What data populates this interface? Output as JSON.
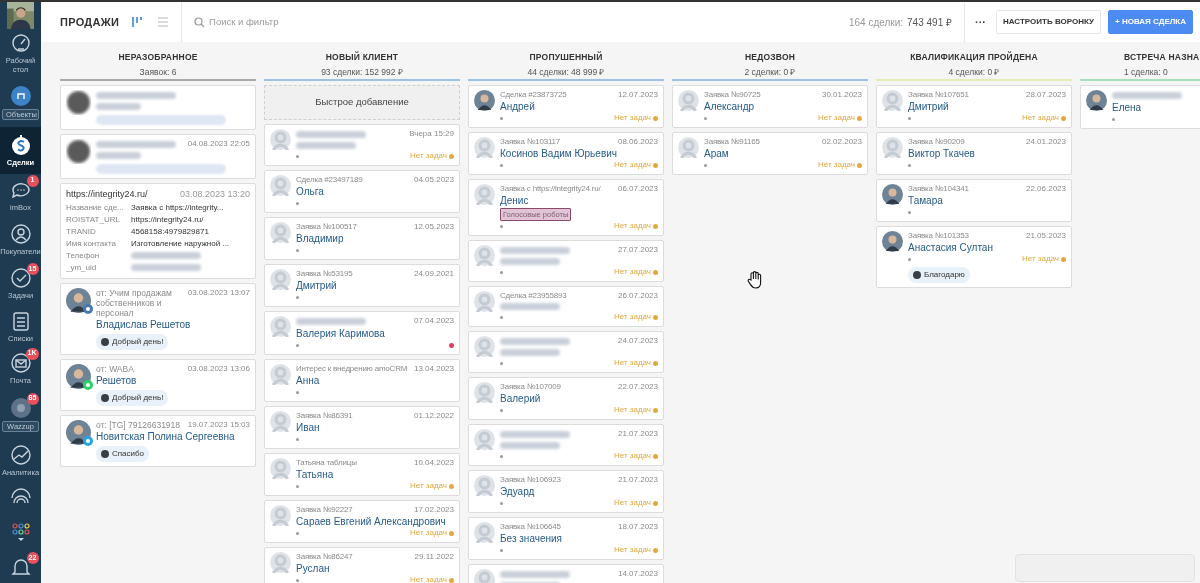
{
  "sidebar": {
    "items": [
      {
        "label": "Рабочий стол",
        "selected": false,
        "kind": "plain"
      },
      {
        "label": "Объекты",
        "selected": false,
        "kind": "boxed"
      },
      {
        "label": "Сделки",
        "selected": true,
        "kind": "plain"
      },
      {
        "label": "imBox",
        "selected": false,
        "kind": "plain",
        "badge": "1"
      },
      {
        "label": "Покупатели",
        "selected": false,
        "kind": "plain"
      },
      {
        "label": "Задачи",
        "selected": false,
        "kind": "plain",
        "badge": "15"
      },
      {
        "label": "Списки",
        "selected": false,
        "kind": "plain"
      },
      {
        "label": "Почта",
        "selected": false,
        "kind": "plain",
        "badge": "1K"
      },
      {
        "label": "Wazzup",
        "selected": false,
        "kind": "boxed",
        "badge": "85"
      },
      {
        "label": "Аналитика",
        "selected": false,
        "kind": "plain"
      },
      {
        "selected": false,
        "kind": "icon"
      },
      {
        "selected": false,
        "kind": "icon"
      },
      {
        "selected": false,
        "kind": "icon",
        "badge": "22"
      }
    ]
  },
  "topbar": {
    "title": "ПРОДАЖИ",
    "views": [
      {
        "selected": true
      },
      {
        "selected": false
      }
    ],
    "search": {
      "placeholder": "Поиск и фильтр"
    },
    "summary_count": "164 сделки:",
    "summary_total": "743 491 ₽",
    "more": "···",
    "buttons": [
      {
        "label": "НАСТРОИТЬ ВОРОНКУ",
        "kind": "secondary"
      },
      {
        "label": "+ НОВАЯ СДЕЛКА",
        "kind": "primary"
      }
    ]
  },
  "columns": [
    {
      "title": "НЕРАЗОБРАННОЕ",
      "subtitle": "Заявок: 6",
      "color": "#a9a9a9",
      "cards": [
        {
          "kind": "message",
          "avatar": {
            "kind": "blurred"
          }
        },
        {
          "kind": "message",
          "avatar": {
            "kind": "blurred"
          },
          "date": "04.08.2023 22:05"
        },
        {
          "kind": "form",
          "title": "https://integrity24.ru/",
          "date": "03.08.2023 13:20",
          "fields": [
            {
              "key": "Название сде...",
              "value": "Заявка с https://integrity..."
            },
            {
              "key": "ROISTAT_URL",
              "value": "https://integrity24.ru/"
            },
            {
              "key": "TRANID",
              "value": "4568158:4979829871"
            },
            {
              "key": "Имя контакта",
              "value": "Изготовление наружной ..."
            },
            {
              "key": "Телефон"
            },
            {
              "key": "_ym_uid"
            }
          ]
        },
        {
          "kind": "message",
          "channel": {
            "kind": "vk"
          },
          "from": "от: Учим продажам собственников и персонал",
          "date": "03.08.2023 13:07",
          "name": "Владислав Решетов",
          "message": "Добрый день!"
        },
        {
          "kind": "message",
          "channel": {
            "kind": "whatsapp"
          },
          "from": "от: WABA",
          "date": "03.08.2023 13:06",
          "name": "Решетов",
          "message": "Добрый день!"
        },
        {
          "kind": "message",
          "channel": {
            "kind": "telegram"
          },
          "from": "от: [TG] 79126631918",
          "date": "19.07.2023 15:03",
          "name": "Новитская Полина Сергеевна",
          "message": "Спасибо"
        }
      ]
    },
    {
      "title": "НОВЫЙ КЛИЕНТ",
      "subtitle": "93 сделки: 152 992 ₽",
      "color": "#9cc3e6",
      "quick_add": "Быстрое добавление",
      "cards": [
        {
          "kind": "deal",
          "avatar": {
            "kind": "placeholder"
          },
          "date": "Вчера 15:29",
          "tasks": "Нет задач",
          "color": "#e3a83e"
        },
        {
          "kind": "deal",
          "avatar": {
            "kind": "placeholder"
          },
          "source": "Сделка #23497189",
          "date": "04.05.2023",
          "name": "Ольга"
        },
        {
          "kind": "deal",
          "avatar": {
            "kind": "placeholder"
          },
          "source": "Заявка №100517",
          "date": "12.05.2023",
          "name": "Владимир"
        },
        {
          "kind": "deal",
          "avatar": {
            "kind": "placeholder"
          },
          "source": "Заявка №53195",
          "date": "24.09.2021",
          "name": "Дмитрий"
        },
        {
          "kind": "deal",
          "avatar": {
            "kind": "placeholder"
          },
          "date": "07.04.2023",
          "name": "Валерия Каримова",
          "color": "#e0405a"
        },
        {
          "kind": "deal",
          "avatar": {
            "kind": "placeholder"
          },
          "source": "Интерес к внедрению amoCRM",
          "date": "13.04.2023",
          "name": "Анна"
        },
        {
          "kind": "deal",
          "avatar": {
            "kind": "placeholder"
          },
          "source": "Заявка №86391",
          "date": "01.12.2022",
          "name": "Иван"
        },
        {
          "kind": "deal",
          "avatar": {
            "kind": "placeholder"
          },
          "source": "Татьяна таблицы",
          "date": "10.04.2023",
          "name": "Татьяна",
          "tasks": "Нет задач",
          "color": "#e3a83e"
        },
        {
          "kind": "deal",
          "avatar": {
            "kind": "placeholder"
          },
          "source": "Заявка №92227",
          "date": "17.02.2023",
          "name": "Сараев Евгений Александрович",
          "tasks": "Нет задач",
          "color": "#e3a83e"
        },
        {
          "kind": "deal",
          "avatar": {
            "kind": "placeholder"
          },
          "source": "Заявка №86247",
          "date": "29.11.2022",
          "name": "Руслан",
          "tasks": "Нет задач",
          "color": "#e3a83e"
        }
      ]
    },
    {
      "title": "ПРОПУШЕННЫЙ",
      "subtitle": "44 сделки: 48 999 ₽",
      "color": "#9cc3e6",
      "cards": [
        {
          "kind": "deal",
          "source": "Сделка #23873725",
          "date": "12.07.2023",
          "name": "Андрей",
          "tasks": "Нет задач",
          "color": "#e3a83e"
        },
        {
          "kind": "deal",
          "avatar": {
            "kind": "placeholder"
          },
          "source": "Заявка №103117",
          "date": "08.06.2023",
          "name": "Косинов Вадим Юрьевич",
          "tasks": "Нет задач",
          "color": "#e3a83e"
        },
        {
          "kind": "deal",
          "avatar": {
            "kind": "placeholder"
          },
          "source": "Заявка с https://integrity24.ru/",
          "date": "06.07.2023",
          "name": "Денис",
          "tag": "Голосовые роботы",
          "tasks": "Нет задач",
          "color": "#e3a83e"
        },
        {
          "kind": "deal",
          "avatar": {
            "kind": "placeholder"
          },
          "date": "27.07.2023",
          "tasks": "Нет задач",
          "color": "#e3a83e"
        },
        {
          "kind": "deal",
          "avatar": {
            "kind": "placeholder"
          },
          "source": "Сделка #23955893",
          "date": "26.07.2023",
          "tasks": "Нет задач",
          "color": "#e3a83e"
        },
        {
          "kind": "deal",
          "avatar": {
            "kind": "placeholder"
          },
          "date": "24.07.2023",
          "tasks": "Нет задач",
          "color": "#e3a83e"
        },
        {
          "kind": "deal",
          "avatar": {
            "kind": "placeholder"
          },
          "source": "Заявка №107009",
          "date": "22.07.2023",
          "name": "Валерий",
          "tasks": "Нет задач",
          "color": "#e3a83e"
        },
        {
          "kind": "deal",
          "avatar": {
            "kind": "placeholder"
          },
          "date": "21.07.2023",
          "tasks": "Нет задач",
          "color": "#e3a83e"
        },
        {
          "kind": "deal",
          "avatar": {
            "kind": "placeholder"
          },
          "source": "Заявка №106923",
          "date": "21.07.2023",
          "name": "Эдуард",
          "tasks": "Нет задач",
          "color": "#e3a83e"
        },
        {
          "kind": "deal",
          "avatar": {
            "kind": "placeholder"
          },
          "source": "Заявка №106645",
          "date": "18.07.2023",
          "name": "Без значения",
          "tasks": "Нет задач",
          "color": "#e3a83e"
        },
        {
          "kind": "deal",
          "avatar": {
            "kind": "placeholder"
          },
          "date": "14.07.2023"
        }
      ]
    },
    {
      "title": "НЕДОЗВОН",
      "subtitle": "2 сделки: 0 ₽",
      "color": "#9cc3e6",
      "cards": [
        {
          "kind": "deal",
          "avatar": {
            "kind": "placeholder"
          },
          "source": "Заявка №90725",
          "date": "30.01.2023",
          "name": "Александр",
          "tasks": "Нет задач",
          "color": "#e3a83e"
        },
        {
          "kind": "deal",
          "avatar": {
            "kind": "placeholder"
          },
          "source": "Заявка №91165",
          "date": "02.02.2023",
          "name": "Арам",
          "tasks": "Нет задач",
          "color": "#e3a83e"
        }
      ]
    },
    {
      "title": "КВАЛИФИКАЦИЯ ПРОЙДЕНА",
      "subtitle": "4 сделки: 0 ₽",
      "color": "#e6ecb4",
      "cards": [
        {
          "kind": "deal",
          "avatar": {
            "kind": "placeholder"
          },
          "source": "Заявка №107651",
          "date": "28.07.2023",
          "name": "Дмитрий",
          "tasks": "Нет задач",
          "color": "#e3a83e"
        },
        {
          "kind": "deal",
          "avatar": {
            "kind": "placeholder"
          },
          "source": "Заявка №90209",
          "date": "24.01.2023",
          "name": "Виктор Ткачев"
        },
        {
          "kind": "deal",
          "source": "Заявка №104341",
          "date": "22.06.2023",
          "name": "Тамара"
        },
        {
          "kind": "deal",
          "source": "Заявка №101353",
          "date": "21.05.2023",
          "name": "Анастасия Султан",
          "tasks": "Нет задач",
          "color": "#e3a83e",
          "message": "Благодарю"
        }
      ]
    },
    {
      "title": "ВСТРЕЧА НАЗНА",
      "subtitle": "1 сделка: 0",
      "color": "#a8e0bf",
      "cards": [
        {
          "kind": "deal",
          "name": "Елена"
        }
      ]
    }
  ]
}
